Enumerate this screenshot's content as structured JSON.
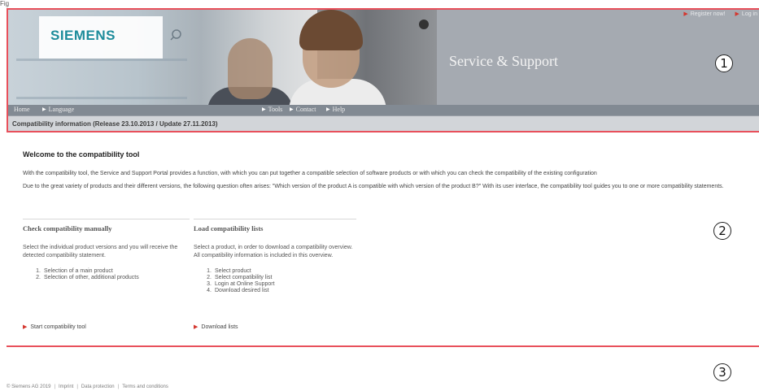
{
  "page_label": "Fig",
  "header": {
    "brand": "SIEMENS",
    "title": "Service & Support",
    "top_links": [
      "Register now!",
      "Log in"
    ],
    "nav": {
      "home": "Home",
      "language": "Language",
      "tools": "Tools",
      "contact": "Contact",
      "help": "Help"
    },
    "compat_bar": "Compatibility information (Release 23.10.2013 / Update 27.11.2013)"
  },
  "markers": [
    "1",
    "2",
    "3"
  ],
  "main": {
    "welcome_title": "Welcome to the compatibility tool",
    "intro1": "With the compatibility tool, the Service and Support Portal provides a function, with which you can put together a compatible selection of software products or with which you can check the compatibility of the existing configuration",
    "intro2": "Due to the great variety of products and their different versions, the following question often arises: \"Which version of the product A is compatible with which version of the product B?\" With its user interface, the compatibility tool guides you to one or more compatibility statements.",
    "check": {
      "title": "Check compatibility manually",
      "desc": "Select the individual product versions and you will receive the detected compatibility statement.",
      "steps": [
        "Selection of a main product",
        "Selection of other, additional products"
      ],
      "link": "Start compatibility tool"
    },
    "load": {
      "title": "Load compatibility lists",
      "desc": "Select a product, in order to download a compatibility overview. All compatibility information is included in this overview.",
      "steps": [
        "Select product",
        "Select compatibility list",
        "Login at Online Support",
        "Download desired list"
      ],
      "link": "Download lists"
    }
  },
  "footer": {
    "copyright": "© Siemens AG 2019",
    "links": [
      "Imprint",
      "Data protection",
      "Terms and conditions"
    ],
    "separator": "|"
  },
  "colors": {
    "region_border": "#e8505b",
    "brand": "#1d8c9b",
    "link_arrow": "#d4372f"
  }
}
